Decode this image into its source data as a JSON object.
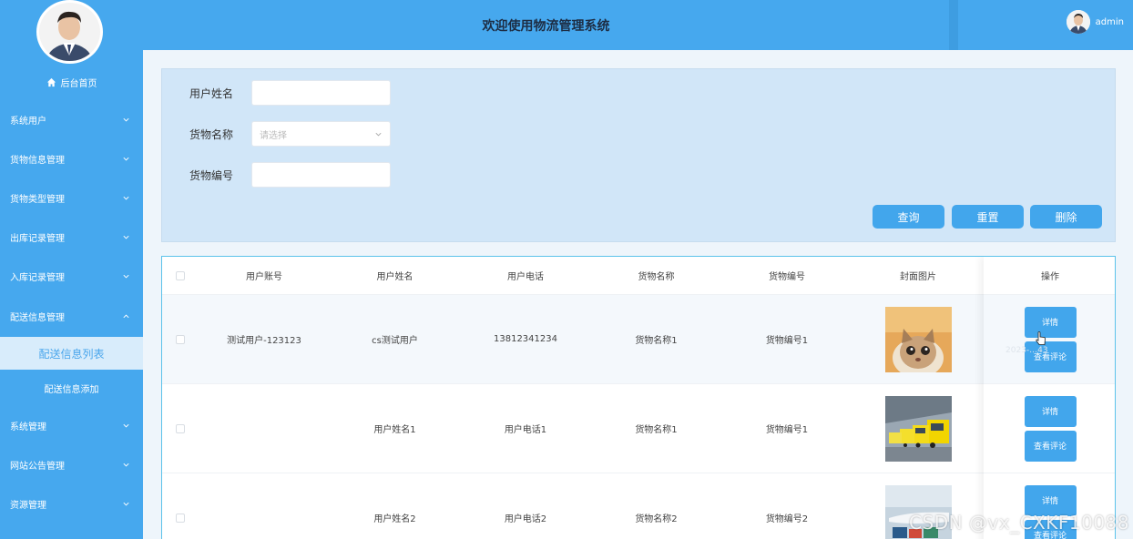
{
  "header": {
    "title": "欢迎使用物流管理系统",
    "username": "admin"
  },
  "sidebar": {
    "home": "后台首页",
    "items": [
      {
        "label": "系统用户"
      },
      {
        "label": "货物信息管理"
      },
      {
        "label": "货物类型管理"
      },
      {
        "label": "出库记录管理"
      },
      {
        "label": "入库记录管理"
      },
      {
        "label": "配送信息管理"
      },
      {
        "label": "系统管理"
      },
      {
        "label": "网站公告管理"
      },
      {
        "label": "资源管理"
      }
    ],
    "subitems": [
      {
        "label": "配送信息列表"
      },
      {
        "label": "配送信息添加"
      }
    ]
  },
  "search": {
    "username_label": "用户姓名",
    "goods_label": "货物名称",
    "goods_placeholder": "请选择",
    "goods_no_label": "货物编号",
    "query_btn": "查询",
    "reset_btn": "重置",
    "delete_btn": "删除"
  },
  "table": {
    "headers": [
      "用户账号",
      "用户姓名",
      "用户电话",
      "货物名称",
      "货物编号",
      "封面图片",
      "操作"
    ],
    "rows": [
      {
        "account": "测试用户-123123",
        "name": "cs测试用户",
        "phone": "13812341234",
        "goods": "货物名称1",
        "goods_no": "货物编号1",
        "image": "cat-photo",
        "ghost": "2023-…43"
      },
      {
        "account": "",
        "name": "用户姓名1",
        "phone": "用户电话1",
        "goods": "货物名称1",
        "goods_no": "货物编号1",
        "image": "trucks-photo"
      },
      {
        "account": "",
        "name": "用户姓名2",
        "phone": "用户电话2",
        "goods": "货物名称2",
        "goods_no": "货物编号2",
        "image": "airplane-photo"
      }
    ],
    "detail_btn": "详情",
    "comment_btn": "查看评论"
  },
  "watermark": "CSDN @vx_CXKF10088",
  "colors": {
    "primary": "#46a8ee",
    "button": "#42a6ec",
    "panel": "#d1e6f8"
  }
}
